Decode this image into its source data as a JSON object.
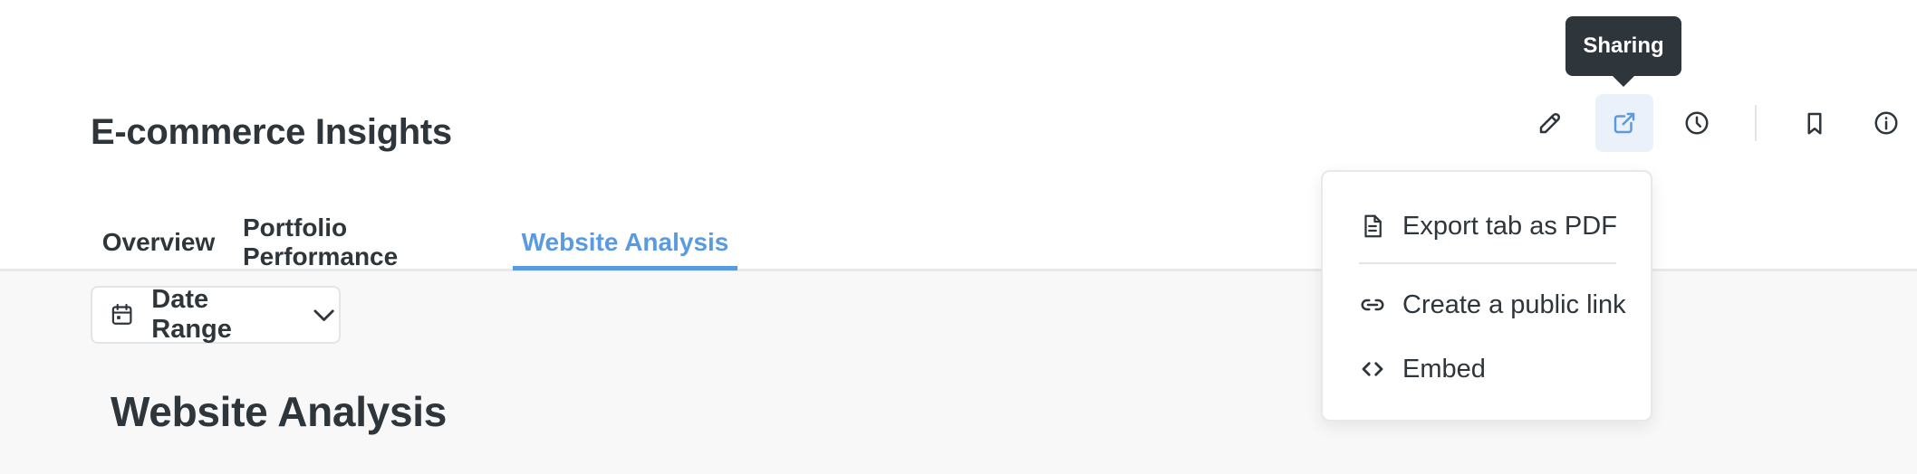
{
  "dashboard": {
    "title": "E-commerce Insights"
  },
  "toolbar": {
    "edit_icon": "pencil-icon",
    "share_icon": "share-icon",
    "history_icon": "clock-icon",
    "bookmark_icon": "bookmark-icon",
    "info_icon": "info-icon",
    "active_color": "#5a9ae0"
  },
  "tooltip": {
    "text": "Sharing"
  },
  "tabs": [
    {
      "label": "Overview",
      "active": false
    },
    {
      "label": "Portfolio Performance",
      "active": false
    },
    {
      "label": "Website Analysis",
      "active": true
    }
  ],
  "filters": {
    "date_range_label": "Date Range",
    "calendar_icon": "calendar-icon",
    "chevron_icon": "chevron-down-icon"
  },
  "section": {
    "title": "Website Analysis"
  },
  "sharing_menu": {
    "items": [
      {
        "label": "Export tab as PDF",
        "icon": "document-icon"
      },
      {
        "label": "Create a public link",
        "icon": "link-icon"
      },
      {
        "label": "Embed",
        "icon": "code-icon"
      }
    ]
  },
  "colors": {
    "accent": "#5a9ae0",
    "text": "#2e353b",
    "tooltip_bg": "#2e353b",
    "content_bg": "#f8f8f8"
  }
}
